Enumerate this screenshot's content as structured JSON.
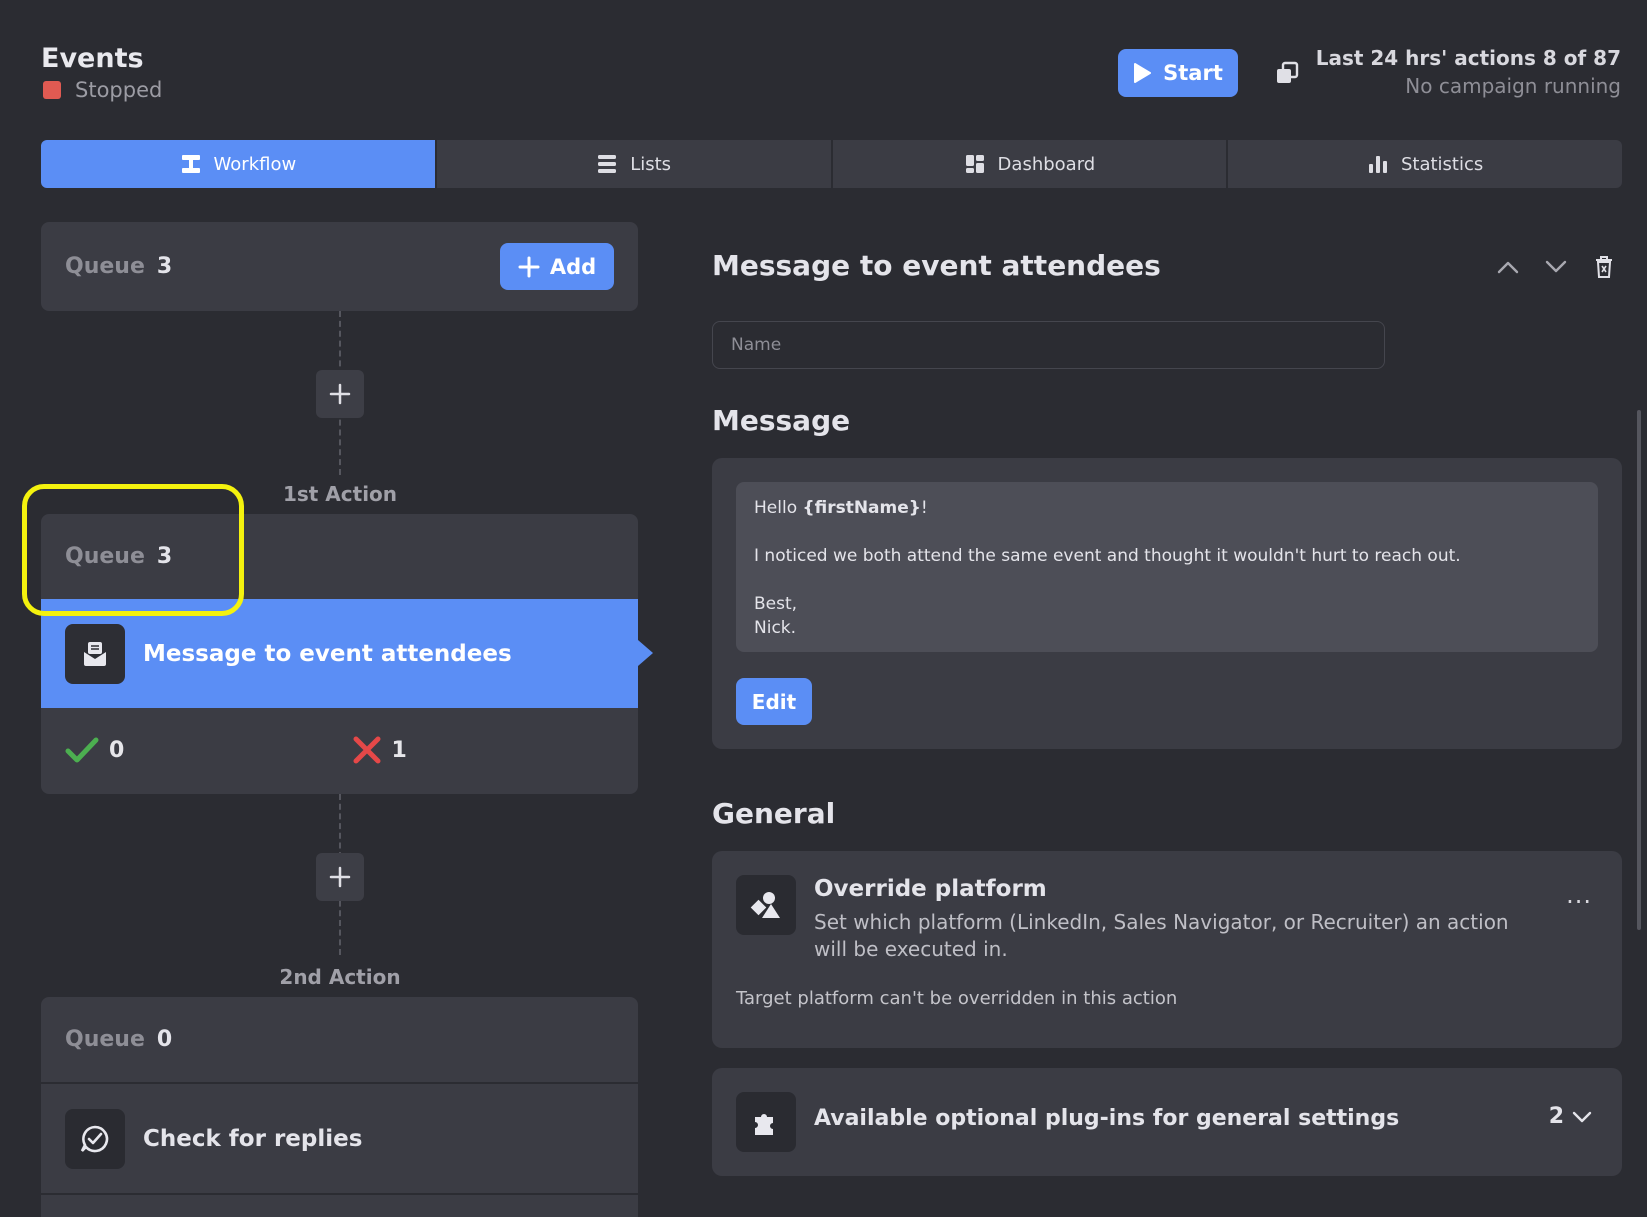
{
  "header": {
    "title": "Events",
    "status": "Stopped",
    "status_color": "#e05a52",
    "start_label": "Start",
    "actions_summary": "Last 24 hrs' actions 8 of 87",
    "campaign_status": "No campaign running"
  },
  "tabs": [
    {
      "label": "Workflow",
      "icon": "workflow-icon",
      "active": true
    },
    {
      "label": "Lists",
      "icon": "list-icon",
      "active": false
    },
    {
      "label": "Dashboard",
      "icon": "dashboard-icon",
      "active": false
    },
    {
      "label": "Statistics",
      "icon": "bar-chart-icon",
      "active": false
    }
  ],
  "workflow": {
    "start_queue": {
      "label": "Queue",
      "value": "3",
      "add_label": "Add"
    },
    "actions": [
      {
        "step_label": "1st Action",
        "queue_label": "Queue",
        "queue_value": "3",
        "name": "Message to event attendees",
        "icon": "message-icon",
        "success_count": "0",
        "fail_count": "1"
      },
      {
        "step_label": "2nd Action",
        "queue_label": "Queue",
        "queue_value": "0",
        "name": "Check for replies",
        "icon": "reply-check-icon"
      }
    ]
  },
  "detail": {
    "title": "Message to event attendees",
    "name_placeholder": "Name",
    "message_section": "Message",
    "message": {
      "greeting": "Hello ",
      "variable": "{firstName}",
      "greeting_end": "!",
      "line2": "I noticed we both attend the same event and thought it wouldn't hurt to reach out.",
      "line3": "Best,",
      "line4": "Nick."
    },
    "edit_label": "Edit",
    "general_section": "General",
    "override": {
      "title": "Override platform",
      "description": "Set which platform (LinkedIn, Sales Navigator, or Recruiter) an action will be executed in.",
      "note": "Target platform can't be overridden in this action",
      "more": "..."
    },
    "plugins": {
      "title": "Available optional plug-ins for general settings",
      "count": "2"
    }
  },
  "colors": {
    "accent": "#5b8ef5",
    "background": "#2b2c32",
    "card": "#3b3c44",
    "success": "#4caf50",
    "fail": "#e54848",
    "highlight": "#f4f20e"
  }
}
